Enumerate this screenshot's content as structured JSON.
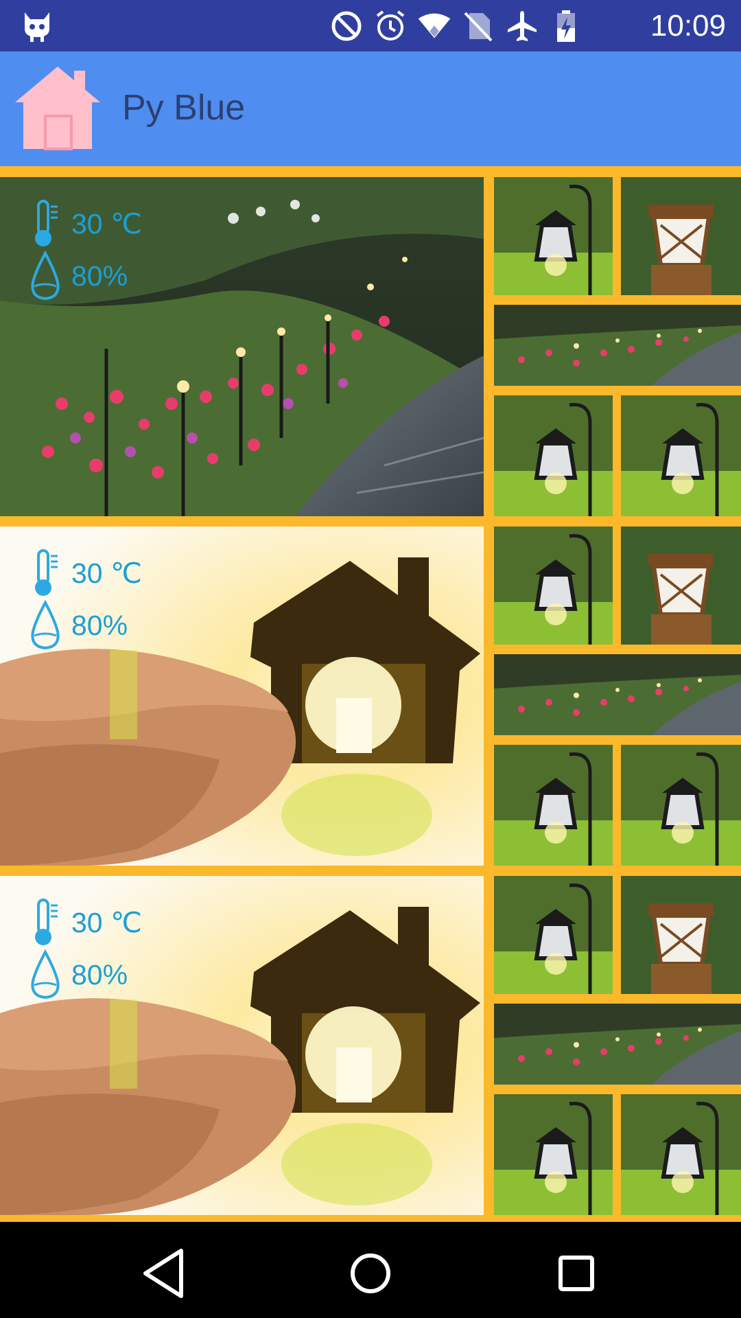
{
  "status_bar": {
    "time": "10:09",
    "icons": [
      "android-cat-icon",
      "do-not-disturb-icon",
      "alarm-icon",
      "wifi-icon",
      "no-sim-icon",
      "airplane-icon",
      "battery-icon"
    ]
  },
  "app_bar": {
    "title": "Py Blue",
    "icon": "home-icon"
  },
  "rooms": [
    {
      "temperature": "30 ℃",
      "humidity": "80%",
      "photo": "garden-path-photo"
    },
    {
      "temperature": "30 ℃",
      "humidity": "80%",
      "photo": "house-in-hand-photo"
    },
    {
      "temperature": "30 ℃",
      "humidity": "80%",
      "photo": "house-in-hand-photo"
    }
  ],
  "thumbnails": [
    "hanging-lantern-photo",
    "post-lantern-photo",
    "garden-path-photo",
    "hanging-lantern-photo",
    "hanging-lantern-photo"
  ],
  "navigation": [
    "back-button",
    "home-button",
    "recents-button"
  ],
  "colors": {
    "status_bar": "#303f9f",
    "app_bar": "#4f8ef0",
    "separator": "#fbb82b",
    "stat_text": "#1b9fd6",
    "home_icon": "#ffc0cb"
  }
}
